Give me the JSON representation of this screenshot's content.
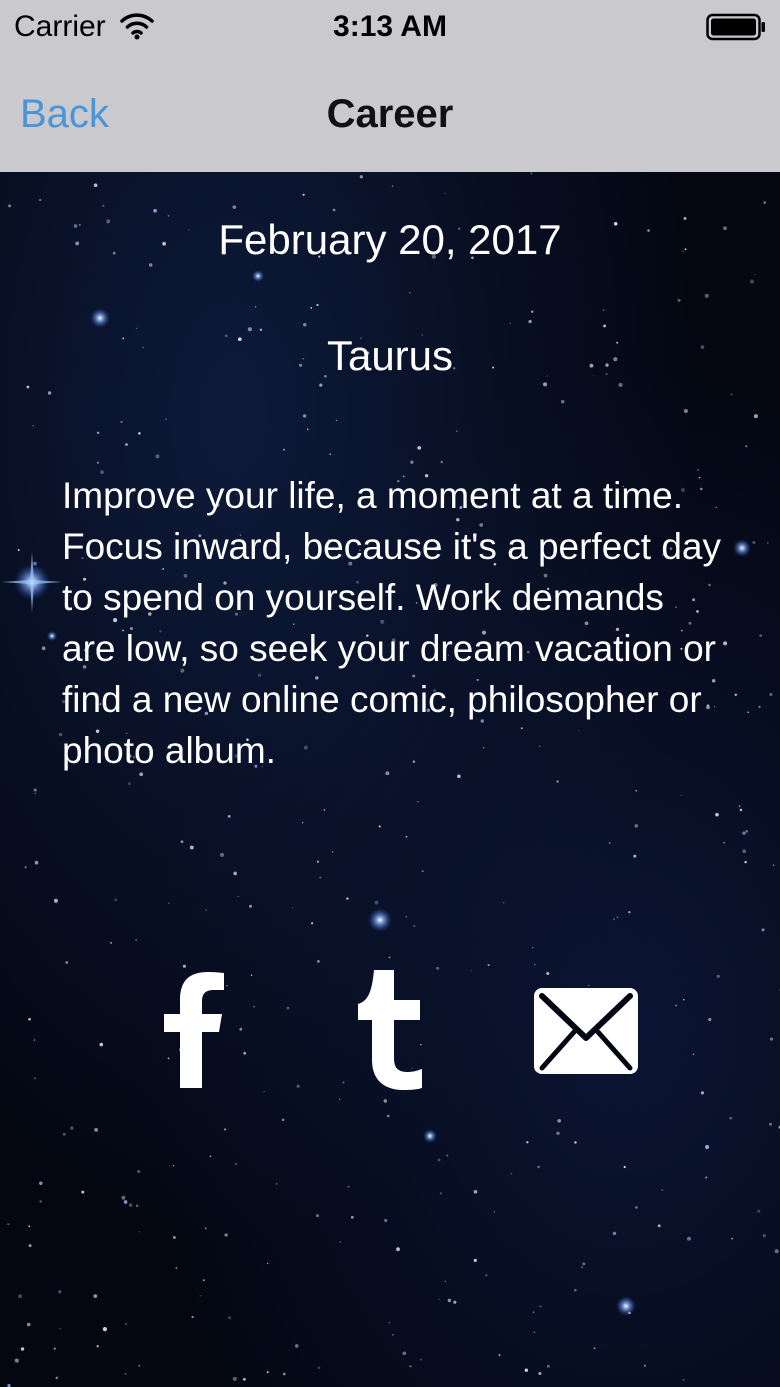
{
  "status_bar": {
    "carrier": "Carrier",
    "time": "3:13 AM",
    "icons": [
      "wifi-icon",
      "battery-icon"
    ]
  },
  "nav": {
    "back_label": "Back",
    "title": "Career"
  },
  "content": {
    "date": "February 20, 2017",
    "sign": "Taurus",
    "horoscope": "Improve your life, a moment at a time. Focus inward, because it's a perfect day to spend on yourself. Work demands are low, so seek your dream vacation or find a new online comic, philosopher or photo album."
  },
  "share": {
    "icons": [
      "facebook-icon",
      "tumblr-icon",
      "mail-icon"
    ]
  },
  "colors": {
    "bar_background": "#c9c9ce",
    "back_link": "#4a95d6",
    "background": "#040712",
    "text": "#ffffff"
  }
}
